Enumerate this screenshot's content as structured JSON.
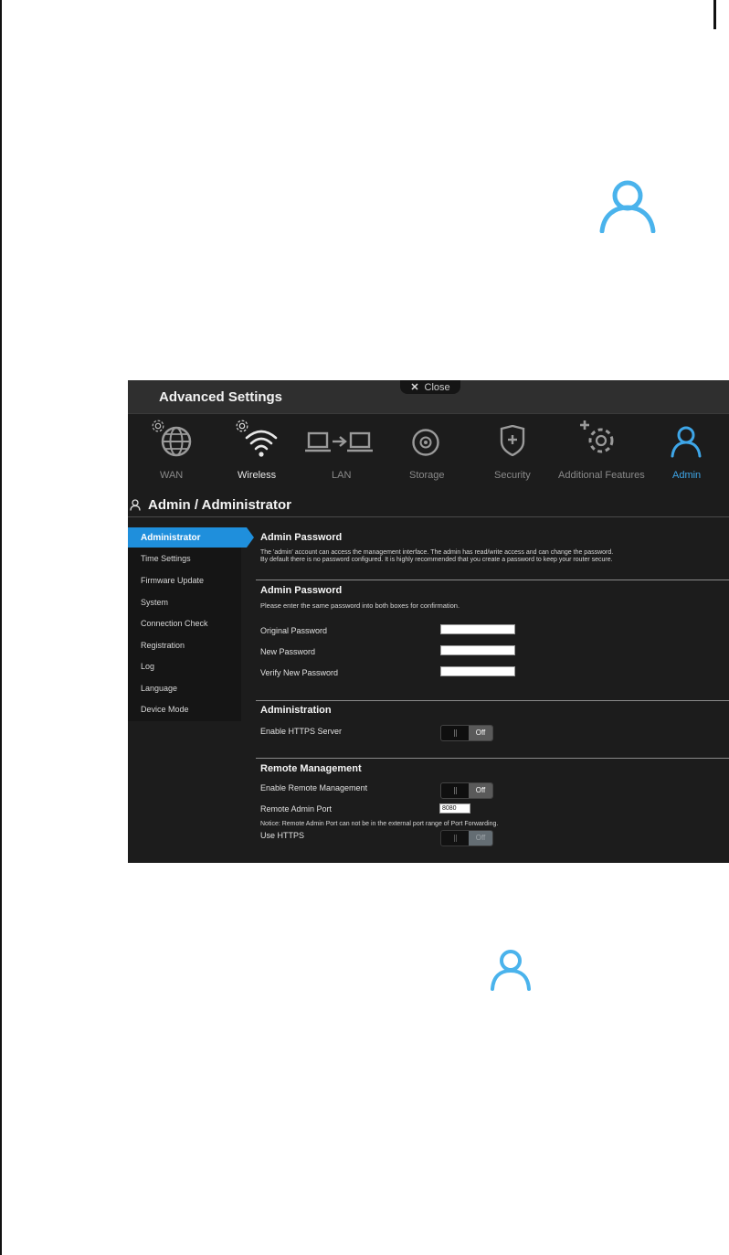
{
  "window": {
    "title": "Advanced Settings",
    "close_label": "Close"
  },
  "nav": {
    "items": [
      {
        "label": "WAN",
        "icon": "globe-icon"
      },
      {
        "label": "Wireless",
        "icon": "wifi-icon"
      },
      {
        "label": "LAN",
        "icon": "lan-icon"
      },
      {
        "label": "Storage",
        "icon": "storage-icon"
      },
      {
        "label": "Security",
        "icon": "shield-icon"
      },
      {
        "label": "Additional Features",
        "icon": "gear-plus-icon"
      },
      {
        "label": "Admin",
        "icon": "user-icon"
      }
    ],
    "active": "Admin",
    "accent_color": "#3ea6e8"
  },
  "page": {
    "heading": "Admin / Administrator"
  },
  "sidebar": {
    "items": [
      {
        "label": "Administrator"
      },
      {
        "label": "Time Settings"
      },
      {
        "label": "Firmware Update"
      },
      {
        "label": "System"
      },
      {
        "label": "Connection Check"
      },
      {
        "label": "Registration"
      },
      {
        "label": "Log"
      },
      {
        "label": "Language"
      },
      {
        "label": "Device Mode"
      }
    ],
    "active": "Administrator"
  },
  "admin_password_info": {
    "title": "Admin Password",
    "line1": "The 'admin' account can access the management interface. The admin has read/write access and can change the password.",
    "line2": "By default there is no password configured. It is highly recommended that you create a password to keep your router secure."
  },
  "admin_password_form": {
    "title": "Admin Password",
    "instructions": "Please enter the same password into both boxes for confirmation.",
    "original_label": "Original Password",
    "original_value": "",
    "new_label": "New Password",
    "new_value": "",
    "verify_label": "Verify New Password",
    "verify_value": ""
  },
  "administration": {
    "title": "Administration",
    "https_label": "Enable HTTPS Server",
    "https_state": "Off"
  },
  "remote_management": {
    "title": "Remote Management",
    "enable_label": "Enable Remote Management",
    "enable_state": "Off",
    "port_label": "Remote Admin Port",
    "port_value": "8080",
    "notice": "Notice: Remote Admin Port can not be in the external port range of Port Forwarding.",
    "use_https_label": "Use HTTPS",
    "use_https_state": "Off"
  }
}
